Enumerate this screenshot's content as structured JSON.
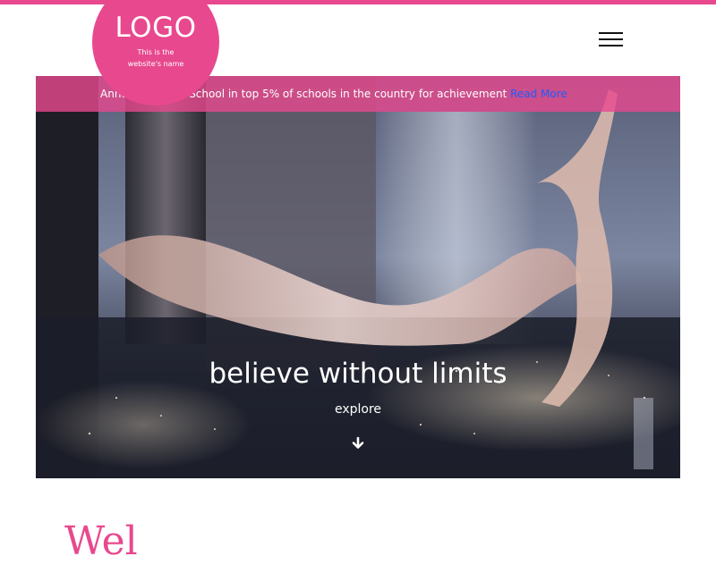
{
  "header": {
    "logo_title": "LOGO",
    "logo_sub_line1": "This is the",
    "logo_sub_line2": "website's name",
    "menu_icon": "hamburger-menu-icon"
  },
  "announcement": {
    "text": "Announcement: School in top 5% of schools in the country for achievement",
    "link_label": "Read More"
  },
  "hero": {
    "title": "believe without limits",
    "explore_label": "explore",
    "arrow_icon": "arrow-down-icon"
  },
  "welcome": {
    "heading": "Wel"
  },
  "colors": {
    "accent": "#e8488e",
    "link": "#1f5cff",
    "text_light": "#ffffff",
    "text_dark": "#111111"
  }
}
